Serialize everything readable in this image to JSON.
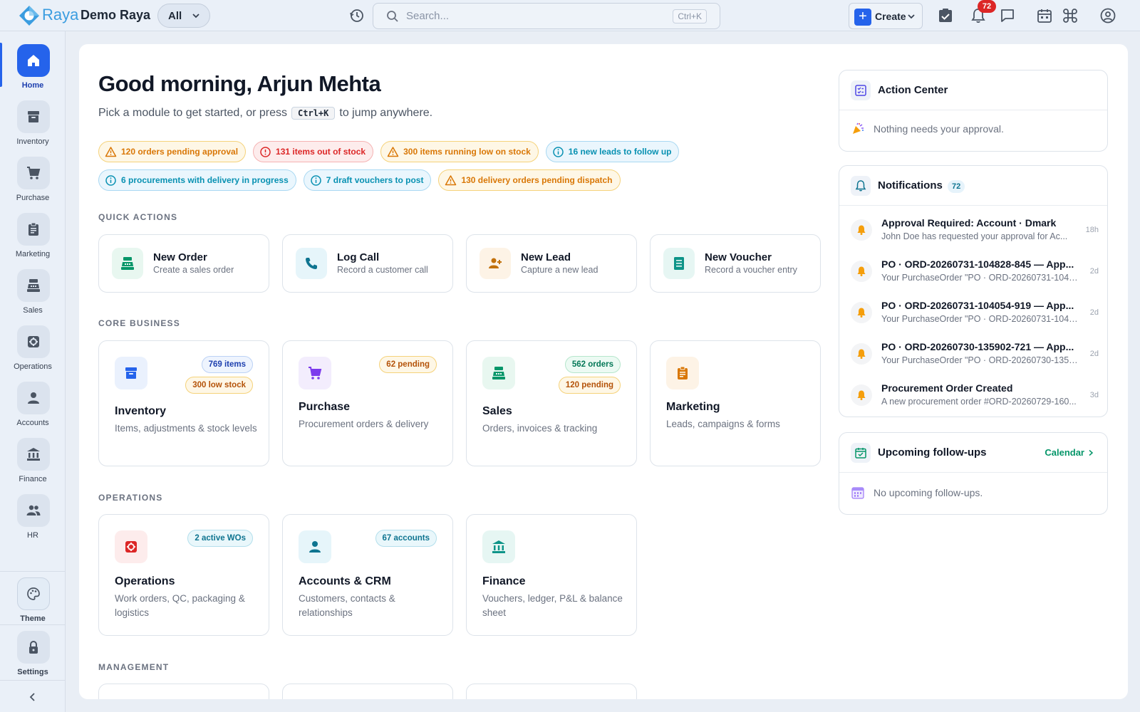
{
  "app": {
    "brand": "Raya",
    "company": "Demo Raya",
    "scope_label": "All"
  },
  "search": {
    "placeholder": "Search...",
    "shortcut": "Ctrl+K"
  },
  "header": {
    "create_label": "Create",
    "notification_count": "72"
  },
  "sidebar": {
    "items": [
      {
        "label": "Home",
        "icon": "home-icon"
      },
      {
        "label": "Inventory",
        "icon": "archive-icon"
      },
      {
        "label": "Purchase",
        "icon": "cart-icon"
      },
      {
        "label": "Marketing",
        "icon": "clipboard-icon"
      },
      {
        "label": "Sales",
        "icon": "register-icon"
      },
      {
        "label": "Operations",
        "icon": "cog-box-icon"
      },
      {
        "label": "Accounts",
        "icon": "person-icon"
      },
      {
        "label": "Finance",
        "icon": "bank-icon"
      },
      {
        "label": "HR",
        "icon": "people-icon"
      }
    ],
    "theme_label": "Theme",
    "settings_label": "Settings"
  },
  "main": {
    "greeting": "Good morning, Arjun Mehta",
    "subtitle_pre": "Pick a module to get started, or press",
    "subtitle_kbd": "Ctrl+K",
    "subtitle_post": "to jump anywhere.",
    "alerts": [
      {
        "text": "120 orders pending approval",
        "kind": "warn"
      },
      {
        "text": "131 items out of stock",
        "kind": "err"
      },
      {
        "text": "300 items running low on stock",
        "kind": "warn"
      },
      {
        "text": "16 new leads to follow up",
        "kind": "info"
      },
      {
        "text": "6 procurements with delivery in progress",
        "kind": "info"
      },
      {
        "text": "7 draft vouchers to post",
        "kind": "info"
      },
      {
        "text": "130 delivery orders pending dispatch",
        "kind": "warn"
      }
    ],
    "sections": {
      "quick_actions": "QUICK ACTIONS",
      "core_business": "CORE BUSINESS",
      "operations": "OPERATIONS",
      "management": "MANAGEMENT"
    },
    "quick_actions": [
      {
        "title": "New Order",
        "desc": "Create a sales order"
      },
      {
        "title": "Log Call",
        "desc": "Record a customer call"
      },
      {
        "title": "New Lead",
        "desc": "Capture a new lead"
      },
      {
        "title": "New Voucher",
        "desc": "Record a voucher entry"
      }
    ],
    "core_modules": [
      {
        "title": "Inventory",
        "desc": "Items, adjustments & stock levels",
        "badges": [
          "769 items",
          "300 low stock"
        ]
      },
      {
        "title": "Purchase",
        "desc": "Procurement orders & delivery",
        "badges": [
          "62 pending"
        ]
      },
      {
        "title": "Sales",
        "desc": "Orders, invoices & tracking",
        "badges": [
          "562 orders",
          "120 pending"
        ]
      },
      {
        "title": "Marketing",
        "desc": "Leads, campaigns & forms",
        "badges": []
      }
    ],
    "ops_modules": [
      {
        "title": "Operations",
        "desc": "Work orders, QC, packaging & logistics",
        "badges": [
          "2 active WOs"
        ]
      },
      {
        "title": "Accounts & CRM",
        "desc": "Customers, contacts & relationships",
        "badges": [
          "67 accounts"
        ]
      },
      {
        "title": "Finance",
        "desc": "Vouchers, ledger, P&L & balance sheet",
        "badges": []
      }
    ]
  },
  "right": {
    "action_center": {
      "title": "Action Center",
      "empty": "Nothing needs your approval."
    },
    "notifications": {
      "title": "Notifications",
      "count": "72",
      "items": [
        {
          "title": "Approval Required: Account · Dmark",
          "desc": "John Doe has requested your approval for Ac...",
          "ago": "18h"
        },
        {
          "title": "PO · ORD-20260731-104828-845 — App...",
          "desc": "Your PurchaseOrder \"PO · ORD-20260731-1048...",
          "ago": "2d"
        },
        {
          "title": "PO · ORD-20260731-104054-919 — App...",
          "desc": "Your PurchaseOrder \"PO · ORD-20260731-1040...",
          "ago": "2d"
        },
        {
          "title": "PO · ORD-20260730-135902-721 — App...",
          "desc": "Your PurchaseOrder \"PO · ORD-20260730-1359...",
          "ago": "2d"
        },
        {
          "title": "Procurement Order Created",
          "desc": "A new procurement order #ORD-20260729-160...",
          "ago": "3d"
        }
      ]
    },
    "followups": {
      "title": "Upcoming follow-ups",
      "link": "Calendar",
      "empty": "No upcoming follow-ups."
    }
  },
  "colors": {
    "accent": "#2563eb",
    "warn": "#d97706",
    "error": "#dc2626",
    "info": "#0891b2",
    "success": "#059669"
  }
}
